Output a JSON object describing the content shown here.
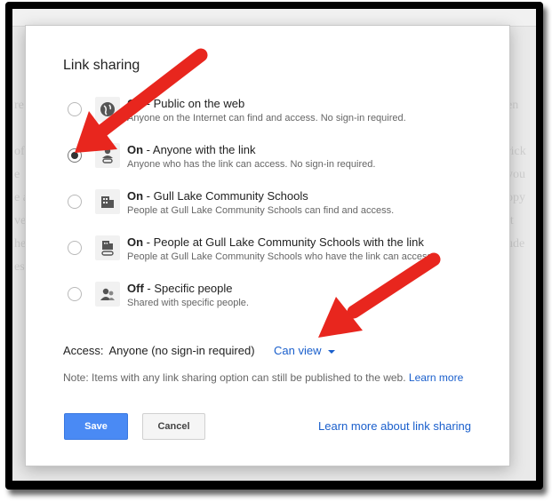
{
  "dialog": {
    "title": "Link sharing",
    "options": [
      {
        "state": "On",
        "desc": " - Public on the web",
        "sub": "Anyone on the Internet can find and access. No sign-in required.",
        "icon": "globe-icon",
        "checked": false
      },
      {
        "state": "On",
        "desc": " - Anyone with the link",
        "sub": "Anyone who has the link can access. No sign-in required.",
        "icon": "person-link-icon",
        "checked": true
      },
      {
        "state": "On",
        "desc": " - Gull Lake Community Schools",
        "sub": "People at Gull Lake Community Schools can find and access.",
        "icon": "building-icon",
        "checked": false
      },
      {
        "state": "On",
        "desc": " - People at Gull Lake Community Schools with the link",
        "sub": "People at Gull Lake Community Schools who have the link can access.",
        "icon": "building-link-icon",
        "checked": false
      },
      {
        "state": "Off",
        "desc": " - Specific people",
        "sub": "Shared with specific people.",
        "icon": "people-icon",
        "checked": false
      }
    ],
    "access_label": "Access:",
    "access_value": "Anyone (no sign-in required)",
    "permission": "Can view",
    "note": "Note: Items with any link sharing option can still be published to the web.",
    "note_link": "Learn more",
    "save_label": "Save",
    "cancel_label": "Cancel",
    "learn_link": "Learn more about link sharing"
  },
  "colors": {
    "link": "#1a5fcc",
    "save_button": "#4a8af4",
    "annotation_arrow": "#e8261e"
  }
}
